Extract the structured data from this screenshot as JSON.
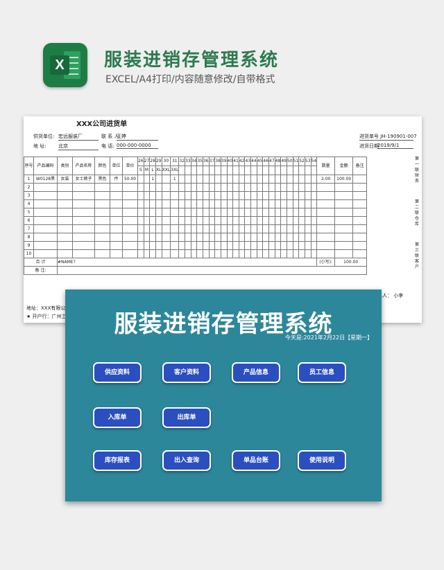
{
  "header": {
    "title": "服装进销存管理系统",
    "subtitle": "EXCEL/A4打印/内容随意修改/自带格式",
    "logo_icon": "excel-icon"
  },
  "sheet": {
    "title": "XXX公司进货单",
    "supplier_label": "供货单位:",
    "supplier_value": "宏远服装厂",
    "contact_label": "联 系 人:",
    "contact_value": "王婷",
    "address_label": "地    址:",
    "address_value": "北京",
    "phone_label": "电    话:",
    "phone_value": "000-000-0000",
    "order_no": "进货单号 JH-190901-007",
    "order_date_label": "进货日期",
    "order_date_value": "2019/9/1",
    "columns": [
      "序号",
      "产品编码",
      "类别",
      "产品名称",
      "颜色",
      "单位",
      "单价"
    ],
    "size_numbers": [
      "26",
      "27",
      "28",
      "29",
      "30",
      "31",
      "32",
      "33",
      "34",
      "35",
      "36",
      "37",
      "38",
      "39",
      "40",
      "41",
      "42",
      "43",
      "44",
      "45",
      "46",
      "47",
      "48",
      "49",
      "50",
      "51",
      "52",
      "53",
      "54"
    ],
    "size_letters": [
      "S",
      "M",
      "L",
      "XL",
      "XXL",
      "3XL"
    ],
    "tail_columns": [
      "数量",
      "金额",
      "备注"
    ],
    "row1": {
      "no": "1",
      "code": "W0128黑",
      "category": "女装",
      "name": "女士裤子",
      "color": "黑色",
      "unit": "件",
      "price": "50.00",
      "qty_l": "1",
      "qty_3xl": "1",
      "qty": "2.00",
      "amount": "100.00"
    },
    "row_numbers": [
      "2",
      "3",
      "4",
      "5",
      "6",
      "7",
      "8",
      "9",
      "10"
    ],
    "total_label": "合    计",
    "total_value": "#NAME?",
    "subtotal_label": "(小写):",
    "subtotal_value": "100.00",
    "note_label": "备    注:",
    "handler": "单人：  小李",
    "footer_address": "地址：XXX有限公司",
    "footer_bank": "★ 开户行：广州工商",
    "side_notes": [
      "第一联财务",
      "第二联仓库",
      "第三联客户"
    ]
  },
  "panel": {
    "title": "服装进销存管理系统",
    "date_text": "今天是:2021年2月22日【星期一】",
    "buttons": {
      "supplier": "供应资料",
      "customer": "客户资料",
      "product": "产品信息",
      "staff": "员工信息",
      "stock_in": "入库单",
      "stock_out": "出库单",
      "inventory_report": "库存报表",
      "io_query": "出入查询",
      "item_ledger": "单品台账",
      "manual": "使用说明"
    }
  },
  "colors": {
    "title_green": "#2d7a4f",
    "panel_teal": "#2d879a",
    "button_blue": "#2b4fbf"
  }
}
